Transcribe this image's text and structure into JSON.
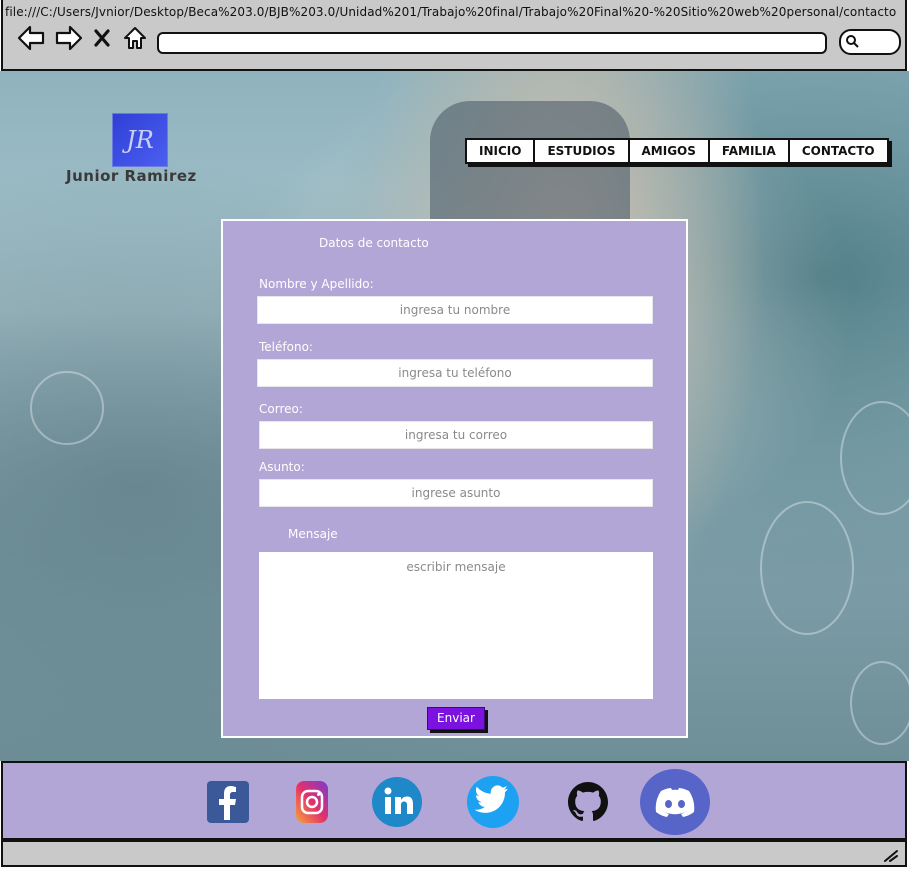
{
  "browser": {
    "url": "file:///C:/Users/Jvnior/Desktop/Beca%203.0/BJB%203.0/Unidad%201/Trabajo%20final/Trabajo%20Final%20-%20Sitio%20web%20personal/contacto",
    "icons": [
      "back-icon",
      "forward-icon",
      "close-icon",
      "home-icon",
      "search-icon"
    ]
  },
  "brand": {
    "logo_text": "JR",
    "name": "Junior Ramirez",
    "logo_color": "#3a4ee0"
  },
  "nav": {
    "items": [
      "INICIO",
      "ESTUDIOS",
      "AMIGOS",
      "FAMILIA",
      "CONTACTO"
    ]
  },
  "form": {
    "title": "Datos de contacto",
    "name_label": "Nombre y Apellido:",
    "name_placeholder": "ingresa tu nombre",
    "phone_label": "Teléfono:",
    "phone_placeholder": "ingresa tu teléfono",
    "email_label": "Correo:",
    "email_placeholder": "ingresa tu correo",
    "subject_label": "Asunto:",
    "subject_placeholder": "ingrese asunto",
    "message_label": "Mensaje",
    "message_placeholder": "escribir mensaje",
    "submit_label": "Enviar",
    "card_color": "#b2a6d6",
    "button_color": "#7b12e0"
  },
  "footer": {
    "social": [
      "facebook-icon",
      "instagram-icon",
      "linkedin-icon",
      "twitter-icon",
      "github-icon",
      "discord-icon"
    ]
  }
}
